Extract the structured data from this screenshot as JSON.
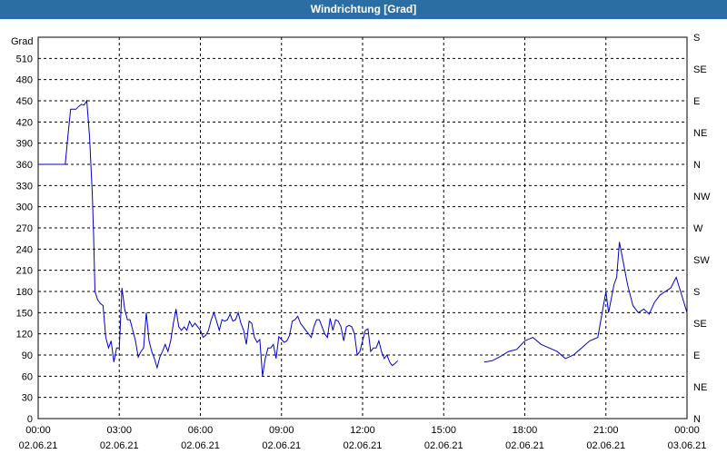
{
  "window": {
    "title": "Windrichtung [Grad]"
  },
  "chart_data": {
    "type": "line",
    "title": "Windrichtung [Grad]",
    "ylabel": "Grad",
    "ylim": [
      0,
      540
    ],
    "ytick_values": [
      0,
      30,
      60,
      90,
      120,
      150,
      180,
      210,
      240,
      270,
      300,
      330,
      360,
      390,
      420,
      450,
      480,
      510
    ],
    "right_axis_labels": [
      "N",
      "NE",
      "E",
      "SE",
      "S",
      "SW",
      "W",
      "NW",
      "N",
      "NE",
      "E",
      "SE",
      "S"
    ],
    "x_ticks": [
      {
        "time": "00:00",
        "date": "02.06.21"
      },
      {
        "time": "03:00",
        "date": "02.06.21"
      },
      {
        "time": "06:00",
        "date": "02.06.21"
      },
      {
        "time": "09:00",
        "date": "02.06.21"
      },
      {
        "time": "12:00",
        "date": "02.06.21"
      },
      {
        "time": "15:00",
        "date": "02.06.21"
      },
      {
        "time": "18:00",
        "date": "02.06.21"
      },
      {
        "time": "21:00",
        "date": "02.06.21"
      },
      {
        "time": "00:00",
        "date": "03.06.21"
      }
    ],
    "grid": true,
    "line_color": "#0000cc",
    "series": [
      {
        "x_hours": [
          0,
          0.5,
          1,
          1.1,
          1.2,
          1.3,
          1.4,
          1.5,
          1.6,
          1.7,
          1.8,
          1.9,
          2.0,
          2.05,
          2.1,
          2.2,
          2.3,
          2.4,
          2.5,
          2.6,
          2.7,
          2.8,
          2.9,
          3.0,
          3.1,
          3.2,
          3.3,
          3.4,
          3.5,
          3.6,
          3.7,
          3.8,
          3.9,
          4.0,
          4.1,
          4.2,
          4.3,
          4.4,
          4.5,
          4.6,
          4.7,
          4.8,
          4.9,
          5.0,
          5.1,
          5.2,
          5.3,
          5.4,
          5.5,
          5.6,
          5.7,
          5.8,
          5.9,
          6.0,
          6.1,
          6.2,
          6.3,
          6.4,
          6.5,
          6.6,
          6.7,
          6.8,
          6.9,
          7.0,
          7.1,
          7.2,
          7.3,
          7.4,
          7.5,
          7.6,
          7.7,
          7.8,
          7.9,
          8.0,
          8.1,
          8.2,
          8.3,
          8.4,
          8.5,
          8.6,
          8.7,
          8.8,
          8.9,
          9.0,
          9.1,
          9.2,
          9.3,
          9.4,
          9.5,
          9.6,
          9.7,
          9.8,
          9.9,
          10.0,
          10.1,
          10.2,
          10.3,
          10.4,
          10.5,
          10.6,
          10.7,
          10.8,
          10.9,
          11.0,
          11.1,
          11.2,
          11.3,
          11.4,
          11.5,
          11.6,
          11.7,
          11.8,
          11.9,
          12.0,
          12.1,
          12.2,
          12.3,
          12.4,
          12.5,
          12.6,
          12.7,
          12.8,
          12.9,
          13.0,
          13.1,
          13.2,
          13.3,
          13.4,
          13.5,
          13.6,
          13.7,
          13.8,
          13.9,
          14.0,
          14.1,
          14.2,
          14.3,
          14.4,
          14.5,
          14.6,
          14.7,
          14.8,
          14.9,
          15.0,
          15.1,
          15.2,
          15.3,
          15.4,
          15.5,
          15.6,
          15.7,
          15.8,
          15.9,
          16.0
        ],
        "y": [
          360,
          360,
          360,
          400,
          438,
          438,
          438,
          442,
          445,
          444,
          450,
          400,
          320,
          260,
          180,
          168,
          163,
          160,
          115,
          100,
          110,
          80,
          100,
          100,
          185,
          155,
          140,
          140,
          125,
          110,
          87,
          95,
          100,
          150,
          110,
          95,
          85,
          72,
          87,
          95,
          105,
          95,
          110,
          135,
          155,
          130,
          125,
          130,
          125,
          138,
          130,
          135,
          130,
          125,
          115,
          118,
          125,
          140,
          150,
          138,
          125,
          140,
          138,
          140,
          148,
          138,
          140,
          150,
          135,
          125,
          105,
          138,
          135,
          115,
          108,
          112,
          60,
          85,
          100,
          100,
          105,
          85,
          116,
          112,
          108,
          110,
          118,
          138,
          140,
          145,
          135,
          130,
          125,
          120,
          115,
          130,
          140,
          140,
          130,
          120,
          115,
          142,
          125,
          140,
          138,
          130,
          110,
          130,
          132,
          130,
          120,
          90,
          95,
          110,
          125,
          127,
          95,
          100,
          100,
          110,
          95,
          85,
          90,
          80,
          75,
          78,
          82
        ]
      },
      {
        "x_hours": [
          16.5,
          16.8,
          17.1,
          17.4,
          17.7,
          18.0,
          18.3,
          18.6,
          18.9,
          19.2,
          19.5,
          19.8,
          20.1,
          20.4,
          20.7,
          21.0,
          21.1,
          21.2,
          21.3,
          21.4,
          21.5,
          21.6,
          21.8,
          22.0,
          22.2,
          22.4,
          22.6,
          22.8,
          23.0,
          23.2,
          23.4,
          23.6,
          23.8,
          24.0
        ],
        "y": [
          80,
          82,
          88,
          95,
          98,
          110,
          115,
          105,
          100,
          95,
          85,
          90,
          100,
          110,
          115,
          180,
          150,
          170,
          190,
          200,
          250,
          230,
          190,
          160,
          150,
          155,
          148,
          165,
          175,
          180,
          185,
          200,
          175,
          150
        ]
      }
    ]
  }
}
